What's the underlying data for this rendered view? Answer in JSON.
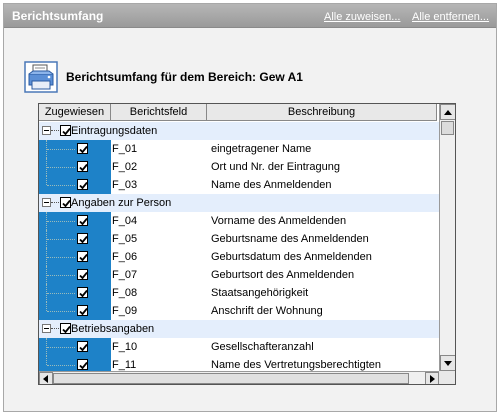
{
  "header": {
    "title": "Berichtsumfang",
    "assign_all": "Alle zuweisen...",
    "remove_all": "Alle entfernen..."
  },
  "section": {
    "icon": "printer-icon",
    "title": "Berichtsumfang für dem Bereich: Gew A1"
  },
  "grid": {
    "columns": [
      "Zugewiesen",
      "Berichtsfeld",
      "Beschreibung"
    ],
    "groups": [
      {
        "label": "Eintragungsdaten",
        "checked": true,
        "expanded": true,
        "items": [
          {
            "code": "F_01",
            "desc": "eingetragener Name",
            "checked": true
          },
          {
            "code": "F_02",
            "desc": "Ort und Nr. der Eintragung",
            "checked": true
          },
          {
            "code": "F_03",
            "desc": "Name des Anmeldenden",
            "checked": true
          }
        ]
      },
      {
        "label": "Angaben zur Person",
        "checked": true,
        "expanded": true,
        "items": [
          {
            "code": "F_04",
            "desc": "Vorname des Anmeldenden",
            "checked": true
          },
          {
            "code": "F_05",
            "desc": "Geburtsname des Anmeldenden",
            "checked": true
          },
          {
            "code": "F_06",
            "desc": "Geburtsdatum des Anmeldenden",
            "checked": true
          },
          {
            "code": "F_07",
            "desc": "Geburtsort des Anmeldenden",
            "checked": true
          },
          {
            "code": "F_08",
            "desc": "Staatsangehörigkeit",
            "checked": true
          },
          {
            "code": "F_09",
            "desc": "Anschrift der Wohnung",
            "checked": true
          }
        ]
      },
      {
        "label": "Betriebsangaben",
        "checked": true,
        "expanded": true,
        "items": [
          {
            "code": "F_10",
            "desc": "Gesellschafteranzahl",
            "checked": true
          },
          {
            "code": "F_11",
            "desc": "Name des Vertretungsberechtigten",
            "checked": true
          }
        ]
      }
    ]
  },
  "colors": {
    "accent": "#1e82c8",
    "group_row": "#e4eefc",
    "titlebar": "#a8a8a8"
  }
}
